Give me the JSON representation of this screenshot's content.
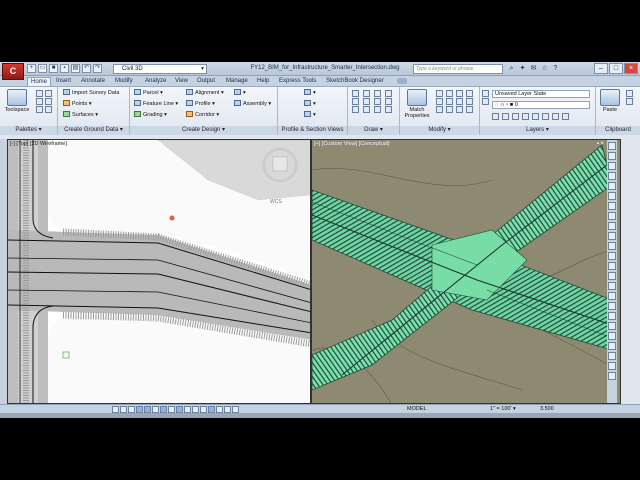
{
  "titlebar": {
    "app_logo": "C",
    "workspace": "Civil 3D",
    "document_title": "FY12_BIM_for_Infrastructure_Smarter_Intersection.dwg",
    "search_placeholder": "Type a keyword or phrase",
    "window_buttons": [
      "–",
      "□",
      "×"
    ]
  },
  "tabs": [
    "Home",
    "Insert",
    "Annotate",
    "Modify",
    "Analyze",
    "View",
    "Output",
    "Manage",
    "Help",
    "Express Tools",
    "SketchBook Designer"
  ],
  "active_tab": "Home",
  "ribbon": {
    "toolspace_label": "Toolspace",
    "create_ground_data": {
      "import_survey": "Import Survey Data",
      "points": "Points",
      "surfaces": "Surfaces"
    },
    "create_design": {
      "parcel": "Parcel",
      "feature_line": "Feature Line",
      "grading": "Grading",
      "alignment": "Alignment",
      "profile": "Profile",
      "corridor": "Corridor",
      "assembly": "Assembly"
    },
    "modify": {
      "match_properties": "Match Properties"
    },
    "layers": {
      "layer_state": "Unsaved Layer State",
      "current_layer": "0"
    },
    "clipboard": {
      "paste": "Paste"
    },
    "panel_titles": {
      "palettes": "Palettes ▾",
      "ground": "Create Ground Data ▾",
      "design": "Create Design ▾",
      "profile_section": "Profile & Section Views",
      "draw": "Draw ▾",
      "modify": "Modify ▾",
      "layers": "Layers ▾",
      "clipboard": "Clipboard"
    }
  },
  "viewports": {
    "left_label": "[-] [Top] [2D Wireframe]",
    "right_label": "[+] [Custom View] [Conceptual]",
    "view_label": "WCS"
  },
  "statusbar": {
    "model": "MODEL",
    "scale": "1\" = 100' ▾",
    "zoom": "3.500"
  },
  "colors": {
    "terrain": "#8e8a71",
    "road_green": "#6fd6a3",
    "road_edge": "#1f4a3a",
    "ribbon_bg": "#e4ebf3"
  }
}
